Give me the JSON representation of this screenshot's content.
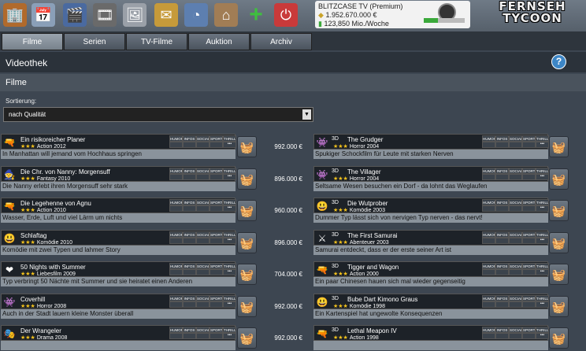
{
  "toolbar": {
    "icons": [
      "office-icon",
      "calendar-icon",
      "director-chair-icon",
      "film-reel-icon",
      "picture-icon",
      "envelope-icon",
      "pie-chart-icon",
      "studio-icon",
      "add-icon",
      "power-icon"
    ]
  },
  "status": {
    "channel": "BLITZCASE TV (Premium)",
    "money": "1.952.670.000 €",
    "audience": "123,850 Mio./Woche",
    "progress": 0.35
  },
  "logo": {
    "line1": "FERNSEH",
    "line2": "TYCOON"
  },
  "tabs": [
    "Filme",
    "Serien",
    "TV-Filme",
    "Auktion",
    "Archiv"
  ],
  "active_tab": "Filme",
  "header": {
    "title": "Videothek",
    "section": "Filme"
  },
  "sort": {
    "label": "Sortierung:",
    "value": "nach Qualität"
  },
  "category_labels": [
    "HUMOR",
    "INFOS",
    "SOCIAL",
    "SPORT",
    "THRILL"
  ],
  "category_more": "•••",
  "left_movies": [
    {
      "title": "Ein risikoreicher Planer",
      "stars": "★★★",
      "genre": "Action 2012",
      "desc": "In Manhattan will jemand vom Hochhaus springen",
      "price": "992.000 €",
      "icon": "gun-icon"
    },
    {
      "title": "Die Chr. von Nanny: Morgensuff",
      "stars": "★★★",
      "genre": "Fantasy 2010",
      "desc": "Die Nanny erlebt ihren Morgensuff sehr stark",
      "price": "896.000 €",
      "icon": "wizard-icon"
    },
    {
      "title": "Die Legehenne von Agnu",
      "stars": "★★★",
      "genre": "Action 2010",
      "desc": "Wasser, Erde, Luft und viel Lärm um nichts",
      "price": "960.000 €",
      "icon": "gun-icon"
    },
    {
      "title": "Schlaftag",
      "stars": "★★★",
      "genre": "Komödie 2010",
      "desc": "Komödie mit zwei Typen und lahmer Story",
      "price": "896.000 €",
      "icon": "comedy-icon"
    },
    {
      "title": "50 Nights with Summer",
      "stars": "★★★",
      "genre": "Liebesfilm 2009",
      "desc": "Typ verbringt 50 Nächte mit Summer und sie heiratet einen Anderen",
      "price": "704.000 €",
      "icon": "heart-icon"
    },
    {
      "title": "Coverhill",
      "stars": "★★★",
      "genre": "Horror 2008",
      "desc": "Auch in der Stadt lauern kleine Monster überall",
      "price": "992.000 €",
      "icon": "monster-icon"
    },
    {
      "title": "Der Wrangeler",
      "stars": "★★★",
      "genre": "Drama 2008",
      "desc": "",
      "price": "992.000 €",
      "icon": "drama-icon"
    }
  ],
  "right_movies": [
    {
      "title": "The Grudger",
      "stars": "★★★",
      "genre": "Horror 2004",
      "desc": "Spukiger Schockfilm für Leute mit starken Nerven",
      "icon": "monster-icon"
    },
    {
      "title": "The Villager",
      "stars": "★★★",
      "genre": "Horror 2004",
      "desc": "Seltsame Wesen besuchen ein Dorf - da lohnt das Weglaufen",
      "icon": "monster-icon"
    },
    {
      "title": "Die Wutprober",
      "stars": "★★★",
      "genre": "Komödie 2003",
      "desc": "Dummer Typ lässt sich von nervigen Typ nerven - das nervt!",
      "icon": "comedy-icon"
    },
    {
      "title": "The First Samurai",
      "stars": "★★★",
      "genre": "Abenteuer 2003",
      "desc": "Samurai entdeckt, dass er der erste seiner Art ist",
      "icon": "adventure-icon"
    },
    {
      "title": "Tigger and Wagon",
      "stars": "★★★",
      "genre": "Action 2000",
      "desc": "Ein paar Chinesen hauen sich mal wieder gegenseitig",
      "icon": "gun-icon"
    },
    {
      "title": "Bube Dart Kimono Graus",
      "stars": "★★★",
      "genre": "Komödie 1998",
      "desc": "Ein Kartenspiel hat ungewolte Konsequenzen",
      "icon": "comedy-icon"
    },
    {
      "title": "Lethal Meapon IV",
      "stars": "★★★",
      "genre": "Action 1998",
      "desc": "",
      "icon": "gun-icon"
    }
  ],
  "right_camera_label": "3D"
}
